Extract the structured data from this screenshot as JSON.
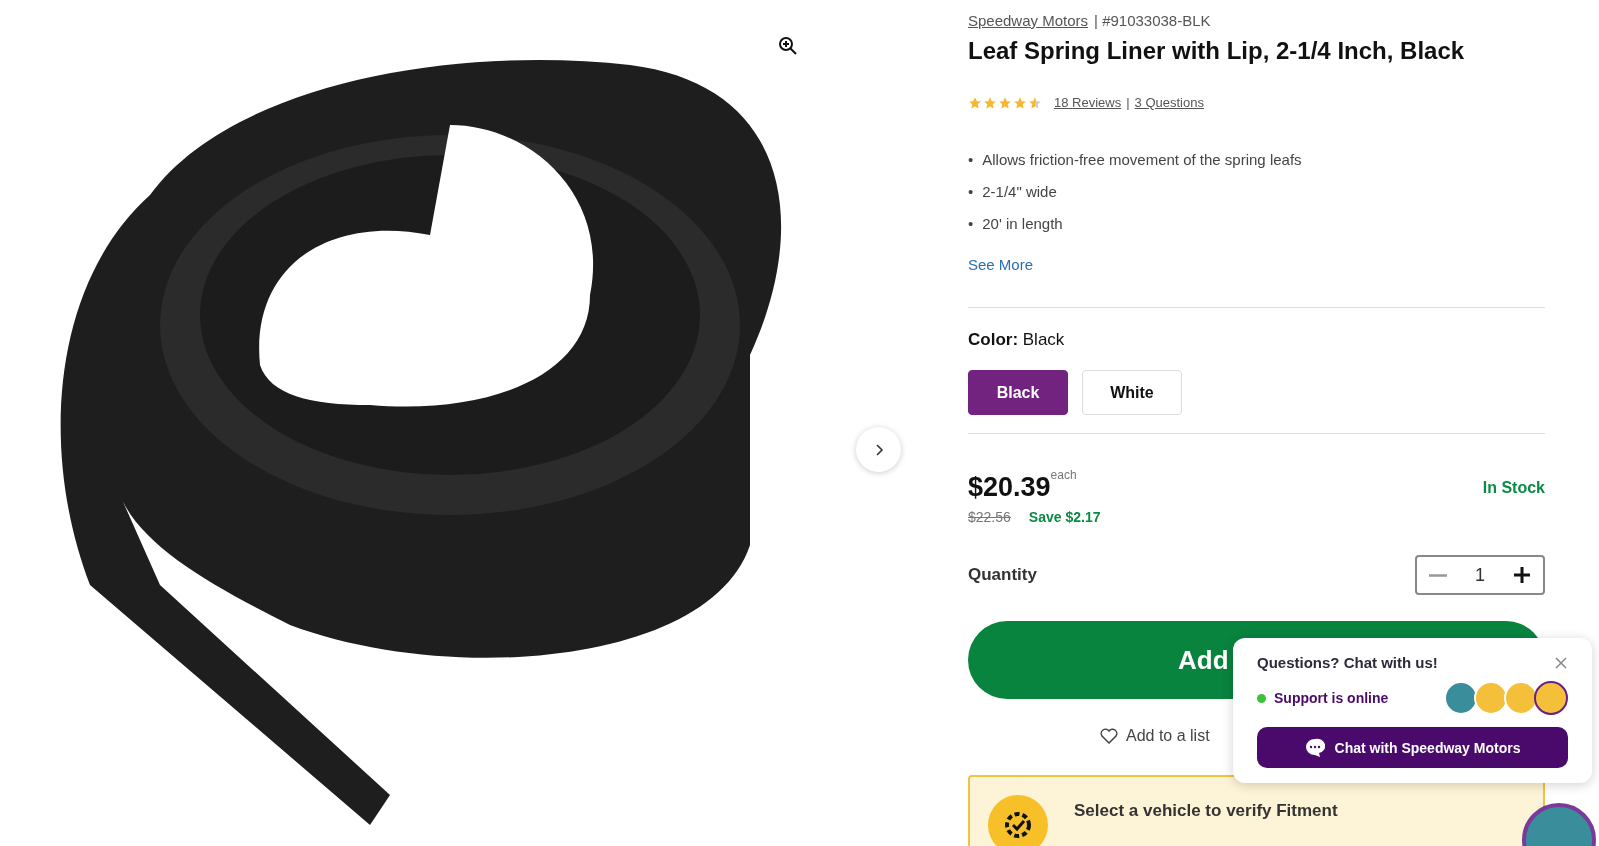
{
  "product": {
    "brand": "Speedway Motors",
    "sku": "| #91033038-BLK",
    "title": "Leaf Spring Liner with Lip, 2-1/4 Inch, Black",
    "stars": 4.5,
    "reviews": "18 Reviews",
    "separator": "|",
    "questions": "3 Questions",
    "bullet_marker": "•",
    "bullets": [
      "Allows friction-free movement of the spring leafs",
      "2-1/4\" wide",
      "20' in length"
    ],
    "see_more": "See More"
  },
  "color": {
    "label": "Color:",
    "value": "Black",
    "options": [
      {
        "label": "Black",
        "selected": true
      },
      {
        "label": "White",
        "selected": false
      }
    ]
  },
  "price": {
    "current": "$20.39",
    "unit": "each",
    "original": "$22.56",
    "savings": "Save $2.17",
    "stock": "In Stock"
  },
  "quantity": {
    "label": "Quantity",
    "value": "1",
    "decrement_disabled": true
  },
  "add_button": {
    "label": "Add"
  },
  "add_to_list": "Add to a list",
  "fitment": {
    "title": "Select a vehicle to verify Fitment"
  },
  "chat": {
    "title": "Questions? Chat with us!",
    "status": "Support is online",
    "online": true,
    "agents": [
      {
        "kind": "photo"
      },
      {
        "kind": "photo"
      },
      {
        "kind": "photo"
      },
      {
        "kind": "logo"
      }
    ],
    "button": "Chat with Speedway Motors"
  }
}
